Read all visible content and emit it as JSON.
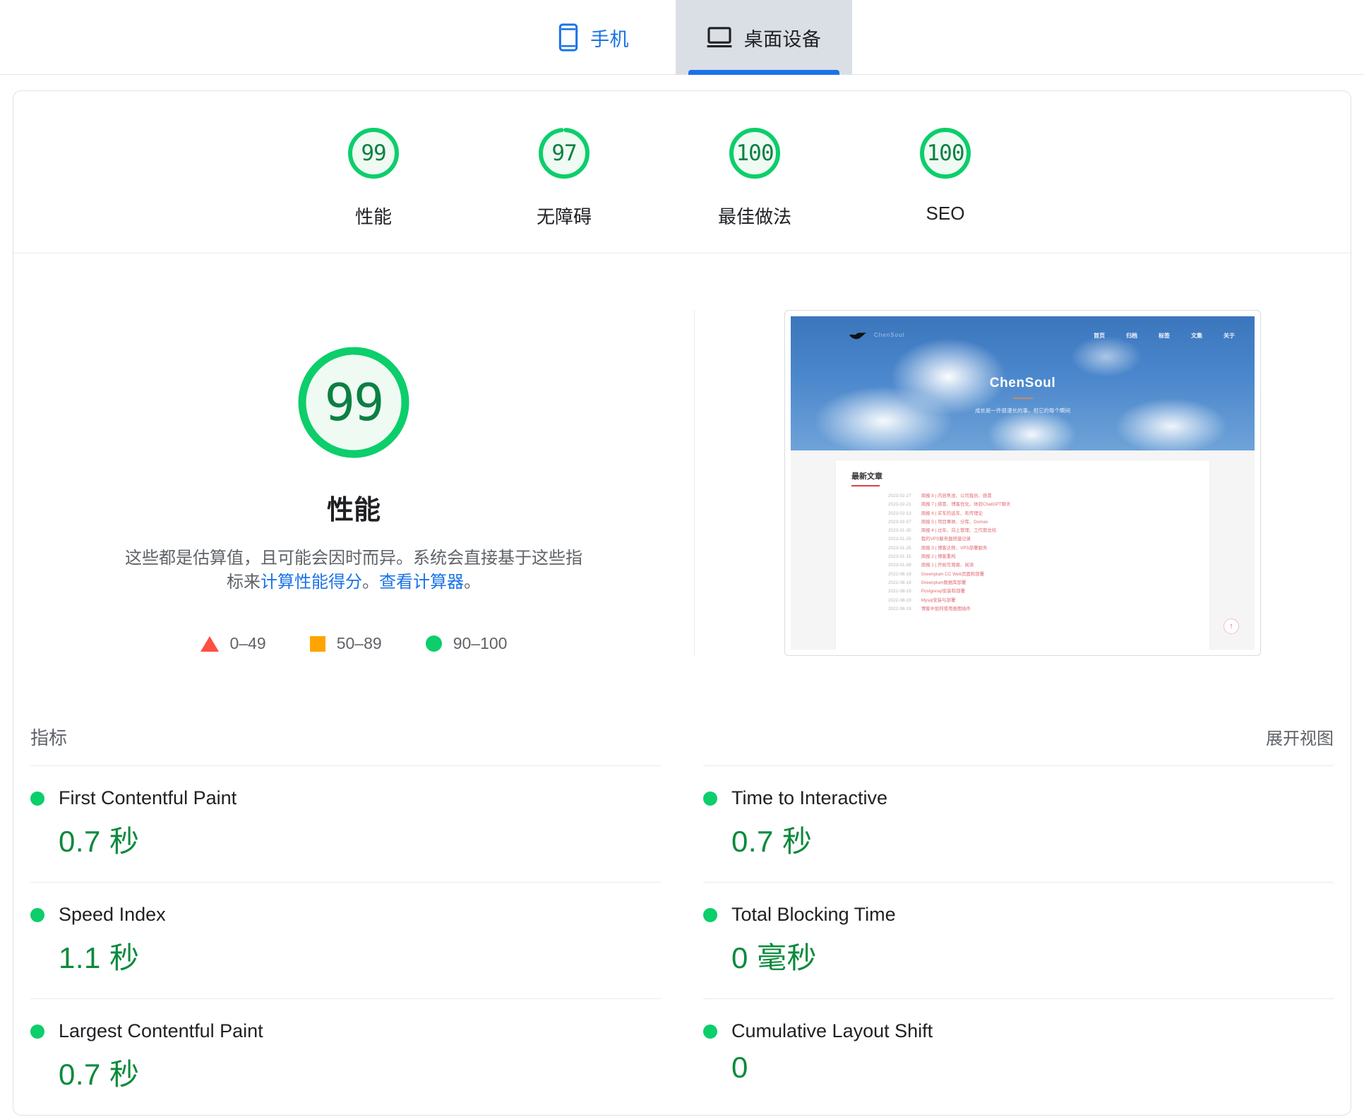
{
  "tabs": [
    {
      "id": "mobile",
      "label": "手机",
      "icon": "mobile-phone-icon",
      "selected": false
    },
    {
      "id": "desktop",
      "label": "桌面设备",
      "icon": "desktop-monitor-icon",
      "selected": true
    }
  ],
  "summary": {
    "scores": [
      {
        "label": "性能",
        "value": "99",
        "pct": 99
      },
      {
        "label": "无障碍",
        "value": "97",
        "pct": 97
      },
      {
        "label": "最佳做法",
        "value": "100",
        "pct": 100
      },
      {
        "label": "SEO",
        "value": "100",
        "pct": 100
      }
    ]
  },
  "performance": {
    "score": "99",
    "pct": 99,
    "title": "性能",
    "desc_part1": "这些都是估算值，且可能会因时而异。系统会直接基于这些指标来",
    "desc_link1": "计算性能得分",
    "desc_part2": "。",
    "desc_link2": "查看计算器",
    "desc_part3": "。",
    "legend": [
      {
        "shape": "triangle",
        "label": "0–49",
        "color": "#ff4e42"
      },
      {
        "shape": "square",
        "label": "50–89",
        "color": "#ffa400"
      },
      {
        "shape": "circle",
        "label": "90–100",
        "color": "#0cce6b"
      }
    ]
  },
  "thumbnail": {
    "site_title": "ChenSoul",
    "site_logo": "ChenSoul",
    "site_subtitle": "成长是一件很漫长的事，但它的每个瞬间",
    "nav": [
      "首页",
      "归档",
      "标签",
      "文集",
      "关于"
    ],
    "posts_title": "最新文章",
    "scroll_top_icon": "arrow-up-icon",
    "posts": [
      {
        "date": "2023-02-27",
        "title": "周报 8 | 内容焦虑、公司裁员、感冒"
      },
      {
        "date": "2023-02-21",
        "title": "周报 7 | 感冒、博客优化、体验ChatGPT聊天"
      },
      {
        "date": "2023-02-13",
        "title": "周报 6 | 买车的选车、布传理论"
      },
      {
        "date": "2023-02-07",
        "title": "周报 5 | 项目事故、分库、Domax"
      },
      {
        "date": "2023-01-30",
        "title": "周报 4 | 过年、向上管理、工作期总结"
      },
      {
        "date": "2023-01-25",
        "title": "我的VPS服务器搭建记录"
      },
      {
        "date": "2023-01-25",
        "title": "周报 3 | 博客迁移、VPS部署服务"
      },
      {
        "date": "2023-01-15",
        "title": "周报 2 | 博客重构"
      },
      {
        "date": "2023-01-08",
        "title": "周报 1 | 开始写周报、阅读"
      },
      {
        "date": "2022-08-19",
        "title": "Greenplum CC Web页面和部署"
      },
      {
        "date": "2022-08-19",
        "title": "Greenplum数据库部署"
      },
      {
        "date": "2022-08-19",
        "title": "Postgresql安装和部署"
      },
      {
        "date": "2022-08-19",
        "title": "Mysql安装与部署"
      },
      {
        "date": "2022-08-19",
        "title": "博客中如何使用画图插件"
      }
    ]
  },
  "metrics_section": {
    "heading": "指标",
    "expand_label": "展开视图",
    "items": [
      {
        "name": "First Contentful Paint",
        "value": "0.7 秒",
        "status": "good"
      },
      {
        "name": "Time to Interactive",
        "value": "0.7 秒",
        "status": "good"
      },
      {
        "name": "Speed Index",
        "value": "1.1 秒",
        "status": "good"
      },
      {
        "name": "Total Blocking Time",
        "value": "0 毫秒",
        "status": "good"
      },
      {
        "name": "Largest Contentful Paint",
        "value": "0.7 秒",
        "status": "good"
      },
      {
        "name": "Cumulative Layout Shift",
        "value": "0",
        "status": "good"
      }
    ]
  },
  "colors": {
    "good": "#0cce6b",
    "good_text": "#0a8a3c",
    "average": "#ffa400",
    "poor": "#ff4e42",
    "link": "#1a73e8",
    "gauge_fill": "#effaf3"
  }
}
